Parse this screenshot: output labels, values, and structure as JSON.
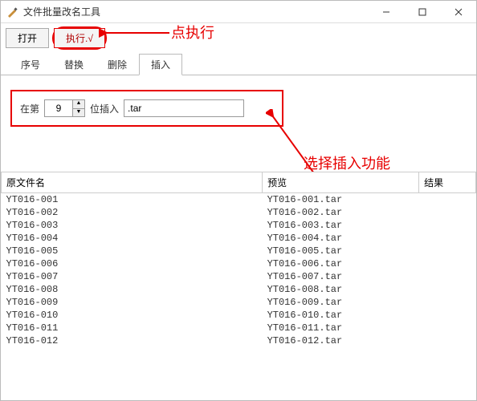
{
  "window": {
    "title": "文件批量改名工具"
  },
  "toolbar": {
    "open_label": "打开",
    "exec_label": "执行.√"
  },
  "annotations": {
    "click_exec": "点执行",
    "choose_insert": "选择插入功能"
  },
  "tabs": {
    "items": [
      {
        "label": "序号"
      },
      {
        "label": "替换"
      },
      {
        "label": "删除"
      },
      {
        "label": "插入"
      }
    ],
    "active_index": 3
  },
  "insert_panel": {
    "prefix_label": "在第",
    "position_value": "9",
    "suffix_label": "位插入",
    "insert_text": ".tar"
  },
  "list": {
    "headers": {
      "original": "原文件名",
      "preview": "预览",
      "result": "结果"
    },
    "rows": [
      {
        "orig": "YT016-001",
        "prev": "YT016-001.tar",
        "res": ""
      },
      {
        "orig": "YT016-002",
        "prev": "YT016-002.tar",
        "res": ""
      },
      {
        "orig": "YT016-003",
        "prev": "YT016-003.tar",
        "res": ""
      },
      {
        "orig": "YT016-004",
        "prev": "YT016-004.tar",
        "res": ""
      },
      {
        "orig": "YT016-005",
        "prev": "YT016-005.tar",
        "res": ""
      },
      {
        "orig": "YT016-006",
        "prev": "YT016-006.tar",
        "res": ""
      },
      {
        "orig": "YT016-007",
        "prev": "YT016-007.tar",
        "res": ""
      },
      {
        "orig": "YT016-008",
        "prev": "YT016-008.tar",
        "res": ""
      },
      {
        "orig": "YT016-009",
        "prev": "YT016-009.tar",
        "res": ""
      },
      {
        "orig": "YT016-010",
        "prev": "YT016-010.tar",
        "res": ""
      },
      {
        "orig": "YT016-011",
        "prev": "YT016-011.tar",
        "res": ""
      },
      {
        "orig": "YT016-012",
        "prev": "YT016-012.tar",
        "res": ""
      }
    ]
  }
}
